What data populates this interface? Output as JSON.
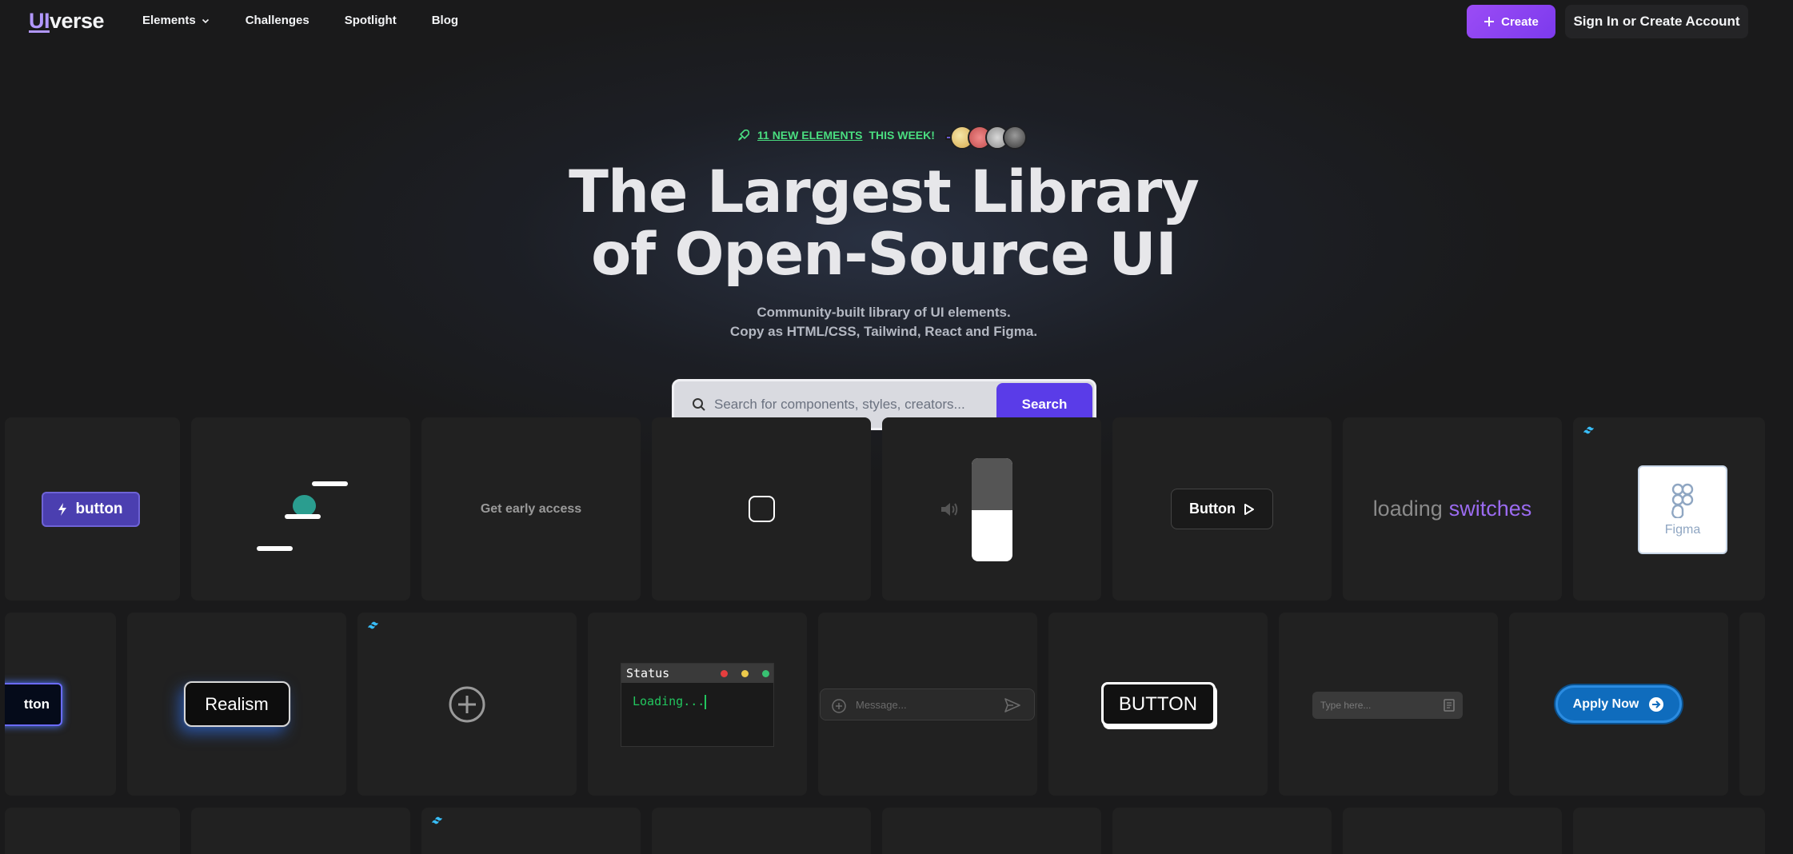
{
  "header": {
    "logo_ui": "UI",
    "logo_rest": "verse",
    "nav": [
      "Elements",
      "Challenges",
      "Spotlight",
      "Blog"
    ],
    "create_label": "Create",
    "sign_in_label": "Sign In or Create Account"
  },
  "hero": {
    "count_label": "11 NEW ELEMENTS",
    "week_label": "THIS WEEK!",
    "title_line1": "The Largest Library",
    "title_line2": "of Open-Source UI",
    "sub_line1": "Community-built library of UI elements.",
    "sub_line2": "Copy as HTML/CSS, Tailwind, React and Figma."
  },
  "search": {
    "placeholder": "Search for components, styles, creators...",
    "button_label": "Search"
  },
  "cards": {
    "button_lightning": "button",
    "early_access": "Get early access",
    "button_play": "Button",
    "loading_word": "loading",
    "switches_word": "switches",
    "figma": "Figma",
    "partial_button": "tton",
    "realism": "Realism",
    "status_title": "Status",
    "status_loading": "Loading...",
    "message_placeholder": "Message...",
    "outline_button": "BUTTON",
    "type_placeholder": "Type here...",
    "apply_now": "Apply Now"
  },
  "colors": {
    "accent": "#7c3aed",
    "search_button": "#5a3ce8",
    "success": "#4ade80",
    "background": "#1a1a1b",
    "card": "#212121"
  }
}
